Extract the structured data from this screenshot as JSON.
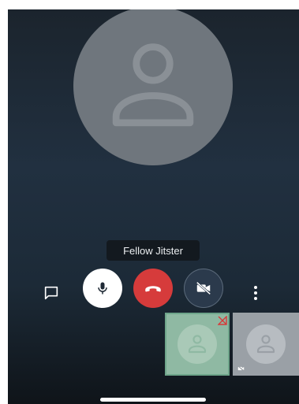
{
  "participant": {
    "name": "Fellow Jitster"
  },
  "icons": {
    "chat": "chat-icon",
    "mic": "microphone-icon",
    "hangup": "hangup-icon",
    "video": "video-off-icon",
    "more": "more-vertical-icon",
    "avatar": "user-avatar-icon",
    "signal": "connection-warning-icon",
    "video_muted": "video-muted-icon"
  },
  "colors": {
    "hangup": "#d63b3b",
    "mic_button": "#ffffff",
    "video_button": "#2b3a4c",
    "local_thumb": "#8fb9a3",
    "remote_thumb": "#9aa0a6"
  }
}
